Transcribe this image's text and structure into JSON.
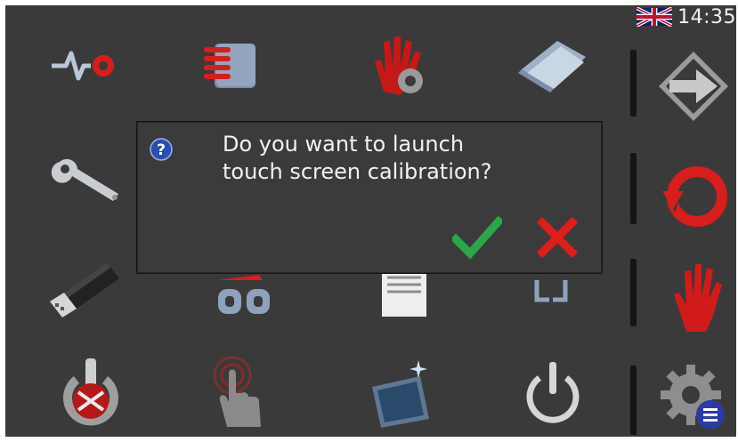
{
  "status": {
    "language_flag": "uk-flag-icon",
    "time": "14:35"
  },
  "dialog": {
    "icon": "question-icon",
    "message_line1": "Do you want to launch",
    "message_line2": "touch screen calibration?",
    "confirm_icon": "checkmark-icon",
    "cancel_icon": "cross-icon"
  },
  "grid_icons": [
    "signal-settings-icon",
    "list-icon",
    "hand-gear-icon",
    "folder-icon",
    "wrench-icon",
    "usb-drive-icon",
    "link-icon",
    "document-icon",
    "bracket-icon",
    "power-network-icon",
    "touch-icon",
    "screen-icon",
    "power-icon"
  ],
  "side_icons": [
    "next-arrow-icon",
    "refresh-icon",
    "hand-icon",
    "settings-menu-icon"
  ],
  "colors": {
    "background": "#3a3a3a",
    "text": "#f2f2f2",
    "confirm": "#2ba64a",
    "cancel": "#e21b1b",
    "accent_red": "#d81d1d"
  }
}
